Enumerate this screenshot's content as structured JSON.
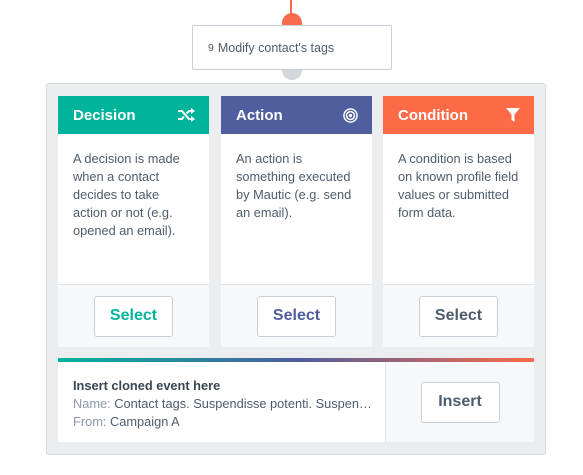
{
  "node": {
    "number": "9",
    "label": "Modify contact's tags"
  },
  "cards": {
    "decision": {
      "title": "Decision",
      "icon": "shuffle-icon",
      "description": "A decision is made when a contact decides to take action or not (e.g. opened an email).",
      "button": "Select",
      "color": "#00b49c"
    },
    "action": {
      "title": "Action",
      "icon": "bullseye-icon",
      "description": "An action is something executed by Mautic (e.g. send an email).",
      "button": "Select",
      "color": "#4e5e9e"
    },
    "condition": {
      "title": "Condition",
      "icon": "filter-icon",
      "description": "A condition is based on known profile field values or submitted form data.",
      "button": "Select",
      "color": "#fd6a48"
    }
  },
  "clone": {
    "title": "Insert cloned event here",
    "name_label": "Name:",
    "name_value": "Contact tags. Suspendisse potenti. Suspendisse potenti.",
    "from_label": "From:",
    "from_value": "Campaign A",
    "button": "Insert"
  }
}
